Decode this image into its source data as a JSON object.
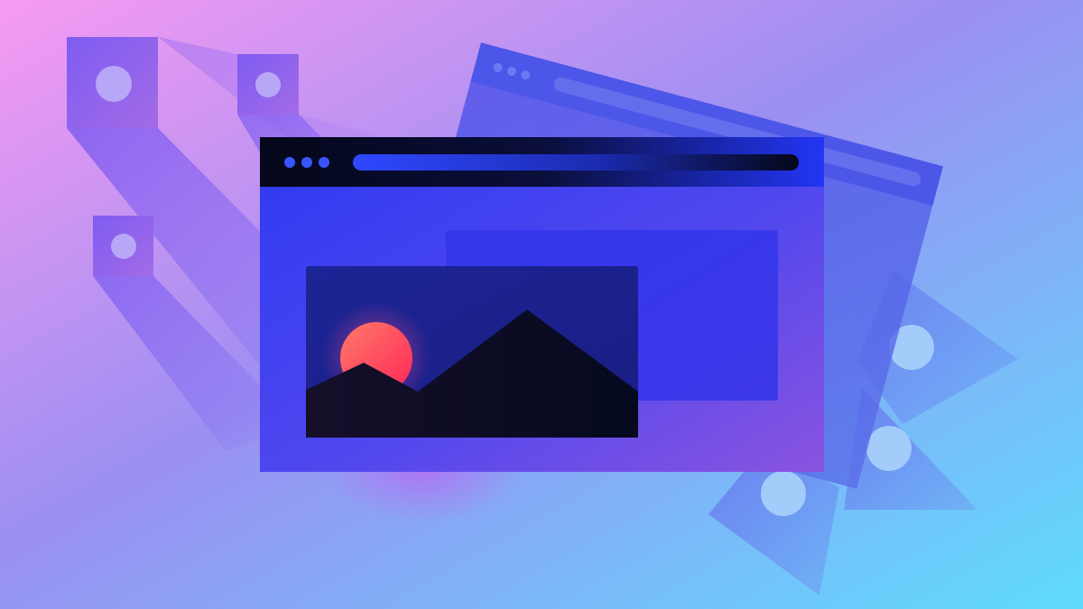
{
  "colors": {
    "background_start": "#f79af2",
    "background_mid": "#9b8ff2",
    "background_end": "#5fdcfd",
    "window_body": "#3a3cf0",
    "window_body_end": "#7a50e8",
    "titlebar": "#05071a",
    "address_bar_start": "#2f48ff",
    "address_bar_end": "#05071a",
    "window_dots": "#3a54ff",
    "image_panel": "#1a1f92",
    "back_panel": "#3335ea",
    "mountains": "#0e0c26",
    "sun_start": "#ff6a6a",
    "sun_end": "#ff2a55",
    "cube_face": "#7a5af0",
    "cube_dot": "#b8a6f6",
    "shape_dot": "#a8d2fb"
  },
  "illustration": {
    "main_window": {
      "dots": 3,
      "icon": "image-placeholder-icon"
    },
    "back_window": {
      "dots": 3
    },
    "floating_cubes": 3,
    "floating_shapes": 3
  }
}
